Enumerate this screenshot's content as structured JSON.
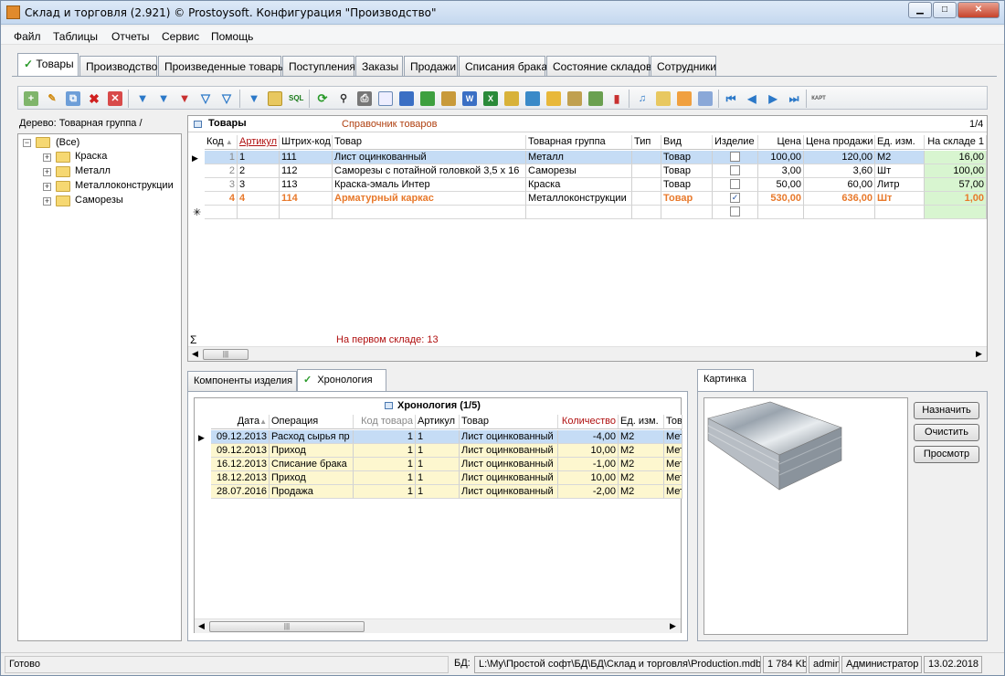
{
  "window": {
    "title": "Склад и торговля (2.921) © Prostoysoft. Конфигурация \"Производство\""
  },
  "menu": [
    "Файл",
    "Таблицы",
    "Отчеты",
    "Сервис",
    "Помощь"
  ],
  "tabs": [
    "Товары",
    "Производство",
    "Произведенные товары",
    "Поступления",
    "Заказы",
    "Продажи",
    "Списания брака",
    "Состояние складов",
    "Сотрудники"
  ],
  "tree": {
    "label": "Дерево: Товарная группа /",
    "root": "(Все)",
    "items": [
      "Краска",
      "Металл",
      "Металлоконструкции",
      "Саморезы"
    ]
  },
  "goods": {
    "title": "Товары",
    "subtitle": "Справочник товаров",
    "counter": "1/4",
    "columns": [
      "Код",
      "Артикул",
      "Штрих-код",
      "Товар",
      "Товарная группа",
      "Тип",
      "Вид",
      "Изделие",
      "Цена",
      "Цена продажи",
      "Ед. изм.",
      "На складе 1"
    ],
    "rows": [
      {
        "code": "1",
        "art": "1",
        "bar": "111",
        "name": "Лист оцинкованный",
        "group": "Металл",
        "type": "",
        "kind": "Товар",
        "item": false,
        "price": "100,00",
        "sale": "120,00",
        "unit": "М2",
        "stock": "16,00"
      },
      {
        "code": "2",
        "art": "2",
        "bar": "112",
        "name": "Саморезы с потайной головкой 3,5 х 16",
        "group": "Саморезы",
        "type": "",
        "kind": "Товар",
        "item": false,
        "price": "3,00",
        "sale": "3,60",
        "unit": "Шт",
        "stock": "100,00"
      },
      {
        "code": "3",
        "art": "3",
        "bar": "113",
        "name": "Краска-эмаль Интер",
        "group": "Краска",
        "type": "",
        "kind": "Товар",
        "item": false,
        "price": "50,00",
        "sale": "60,00",
        "unit": "Литр",
        "stock": "57,00"
      },
      {
        "code": "4",
        "art": "4",
        "bar": "114",
        "name": "Арматурный каркас",
        "group": "Металлоконструкции",
        "type": "",
        "kind": "Товар",
        "item": true,
        "price": "530,00",
        "sale": "636,00",
        "unit": "Шт",
        "stock": "1,00"
      }
    ],
    "footer": "На первом складе: 13"
  },
  "bottom_tabs": [
    "Компоненты изделия",
    "Хронология"
  ],
  "history": {
    "title": "Хронология (1/5)",
    "columns": [
      "Дата",
      "Операция",
      "Код товара",
      "Артикул",
      "Товар",
      "Количество",
      "Ед. изм.",
      "Тов"
    ],
    "rows": [
      {
        "date": "09.12.2013",
        "op": "Расход сырья пр",
        "code": "1",
        "art": "1",
        "name": "Лист оцинкованный",
        "qty": "-4,00",
        "unit": "М2",
        "g": "Мет"
      },
      {
        "date": "09.12.2013",
        "op": "Приход",
        "code": "1",
        "art": "1",
        "name": "Лист оцинкованный",
        "qty": "10,00",
        "unit": "М2",
        "g": "Мет"
      },
      {
        "date": "16.12.2013",
        "op": "Списание брака",
        "code": "1",
        "art": "1",
        "name": "Лист оцинкованный",
        "qty": "-1,00",
        "unit": "М2",
        "g": "Мет"
      },
      {
        "date": "18.12.2013",
        "op": "Приход",
        "code": "1",
        "art": "1",
        "name": "Лист оцинкованный",
        "qty": "10,00",
        "unit": "М2",
        "g": "Мет"
      },
      {
        "date": "28.07.2016",
        "op": "Продажа",
        "code": "1",
        "art": "1",
        "name": "Лист оцинкованный",
        "qty": "-2,00",
        "unit": "М2",
        "g": "Мет"
      }
    ]
  },
  "picture": {
    "tab": "Картинка",
    "buttons": [
      "Назначить",
      "Очистить",
      "Просмотр"
    ]
  },
  "status": {
    "ready": "Готово",
    "db_label": "БД:",
    "db_path": "L:\\My\\Простой софт\\БД\\БД\\Склад и торговля\\Production.mdb",
    "size": "1 784 Kb",
    "user": "admin",
    "role": "Администратор",
    "date": "13.02.2018"
  },
  "colors": {
    "selected_row": "#c5dcf5",
    "highlight_text": "#e8792b",
    "stock_bg": "#d8f5d0",
    "history_bg": "#fdf7cf",
    "red_header": "#b01010"
  }
}
